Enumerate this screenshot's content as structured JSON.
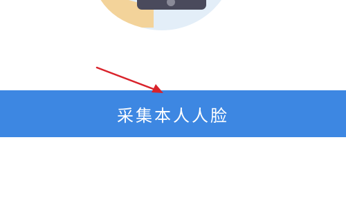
{
  "face_capture": {
    "button_label": "采集本人人脸"
  },
  "colors": {
    "button_bg": "#3d87e2",
    "button_text": "#ffffff",
    "arrow": "#d9232b",
    "illustration_circle": "#e3eef8",
    "illustration_skin": "#f3d39a",
    "illustration_device": "#4a4a5c"
  },
  "icons": {
    "illustration": "face-scan-illustration-icon",
    "annotation": "red-arrow-icon"
  }
}
